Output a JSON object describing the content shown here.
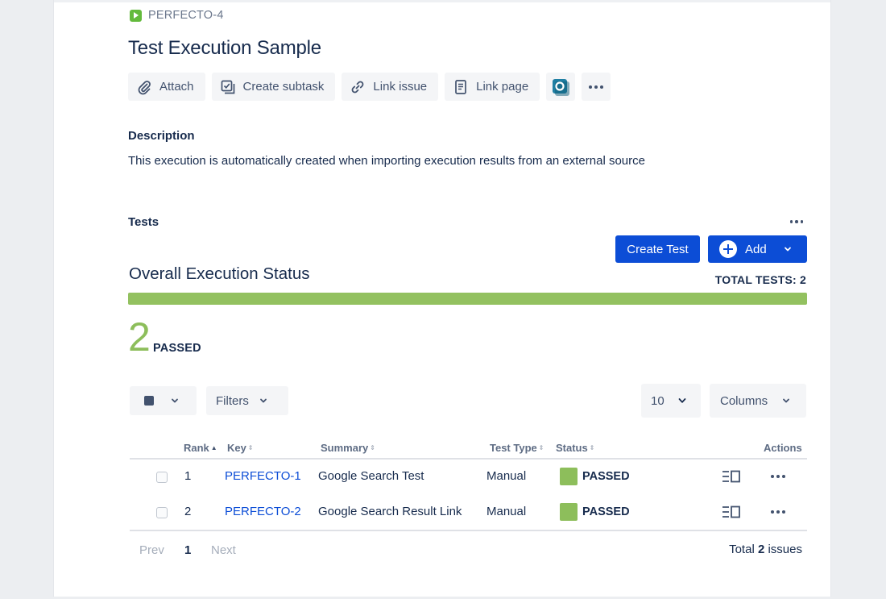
{
  "issue": {
    "key": "PERFECTO-4",
    "title": "Test Execution Sample"
  },
  "actions": {
    "attach": "Attach",
    "create_subtask": "Create subtask",
    "link_issue": "Link issue",
    "link_page": "Link page",
    "app_icon": "app-icon",
    "more_icon": "more-icon"
  },
  "description": {
    "heading": "Description",
    "text": "This execution is automatically created when importing execution results from an external source"
  },
  "tests": {
    "heading": "Tests",
    "create_test": "Create Test",
    "add": "Add"
  },
  "status": {
    "heading": "Overall Execution Status",
    "total_label": "TOTAL TESTS: 2",
    "passed_fraction": 1.0,
    "passed_count": "2",
    "passed_label": "PASSED",
    "passed_color": "#8dbe5b"
  },
  "toolbar": {
    "filters": "Filters",
    "page_size": "10",
    "columns": "Columns"
  },
  "table": {
    "headers": {
      "rank": "Rank",
      "key": "Key",
      "summary": "Summary",
      "test_type": "Test Type",
      "status": "Status",
      "actions": "Actions"
    },
    "rows": [
      {
        "rank": "1",
        "key": "PERFECTO-1",
        "summary": "Google Search Test",
        "test_type": "Manual",
        "status": "PASSED"
      },
      {
        "rank": "2",
        "key": "PERFECTO-2",
        "summary": "Google Search Result Link",
        "test_type": "Manual",
        "status": "PASSED"
      }
    ]
  },
  "pagination": {
    "prev": "Prev",
    "current": "1",
    "next": "Next",
    "total_prefix": "Total",
    "total_count": "2",
    "total_suffix": "issues"
  }
}
